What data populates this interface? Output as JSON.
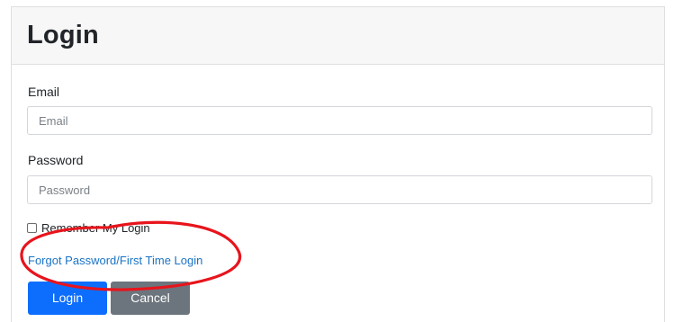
{
  "card": {
    "title": "Login"
  },
  "form": {
    "email_label": "Email",
    "email_placeholder": "Email",
    "email_value": "",
    "password_label": "Password",
    "password_placeholder": "Password",
    "password_value": "",
    "remember_label": "Remember My Login",
    "remember_checked": false,
    "forgot_link": "Forgot Password/First Time Login",
    "login_button": "Login",
    "cancel_button": "Cancel"
  },
  "colors": {
    "primary": "#0d6efd",
    "secondary": "#6c757d",
    "link": "#1a73c6",
    "annotation": "#e8141c"
  }
}
